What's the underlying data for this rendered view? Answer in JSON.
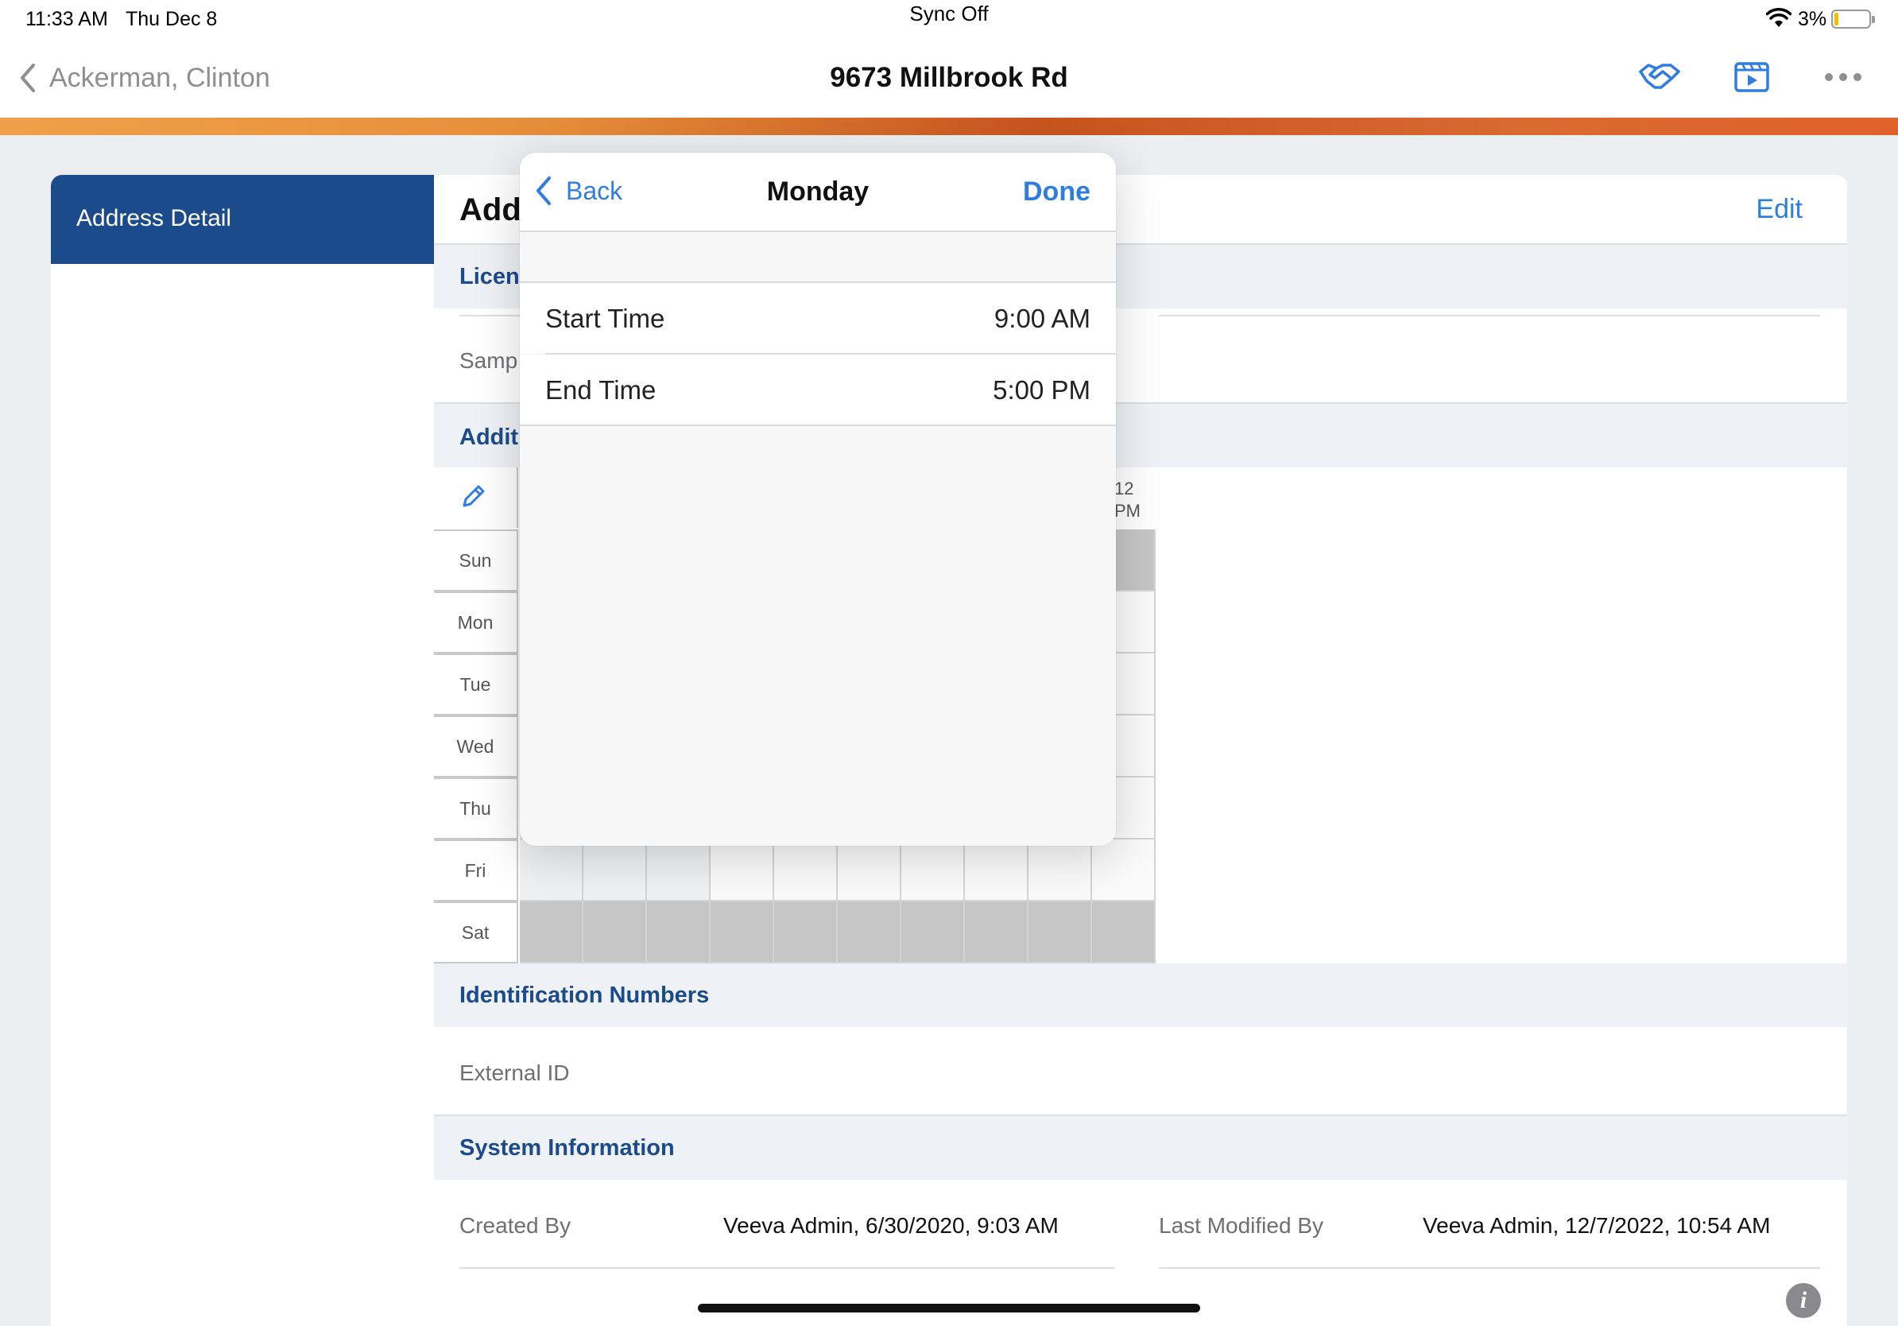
{
  "status_bar": {
    "time": "11:33 AM",
    "date": "Thu Dec 8",
    "sync": "Sync Off",
    "battery": "3%"
  },
  "nav": {
    "back_label": "Ackerman, Clinton",
    "title": "9673 Millbrook Rd",
    "icons": [
      "handshake-icon",
      "video-icon",
      "more-icon"
    ]
  },
  "sidebar": {
    "items": [
      {
        "label": "Address Detail"
      }
    ]
  },
  "main": {
    "title_fragment": "Add",
    "edit_label": "Edit",
    "license_section": "Licen",
    "license_field_fragment": "Samp",
    "additional_section": "Addit",
    "hours_header_fragment": "12",
    "hours_header_fragment2": "PM",
    "days": [
      "Sun",
      "Mon",
      "Tue",
      "Wed",
      "Thu",
      "Fri",
      "Sat"
    ],
    "identification_section": "Identification Numbers",
    "external_id_label": "External ID",
    "system_section": "System Information",
    "created_by_label": "Created By",
    "created_by_value": "Veeva Admin, 6/30/2020, 9:03 AM",
    "modified_by_label": "Last Modified By",
    "modified_by_value": "Veeva Admin, 12/7/2022, 10:54 AM"
  },
  "popover": {
    "back_label": "Back",
    "title": "Monday",
    "done_label": "Done",
    "rows": [
      {
        "label": "Start Time",
        "value": "9:00 AM"
      },
      {
        "label": "End Time",
        "value": "5:00 PM"
      }
    ]
  },
  "colors": {
    "accent": "#2f7de1",
    "brand_navy": "#1c4b8c",
    "orange": "#e58d3a"
  }
}
